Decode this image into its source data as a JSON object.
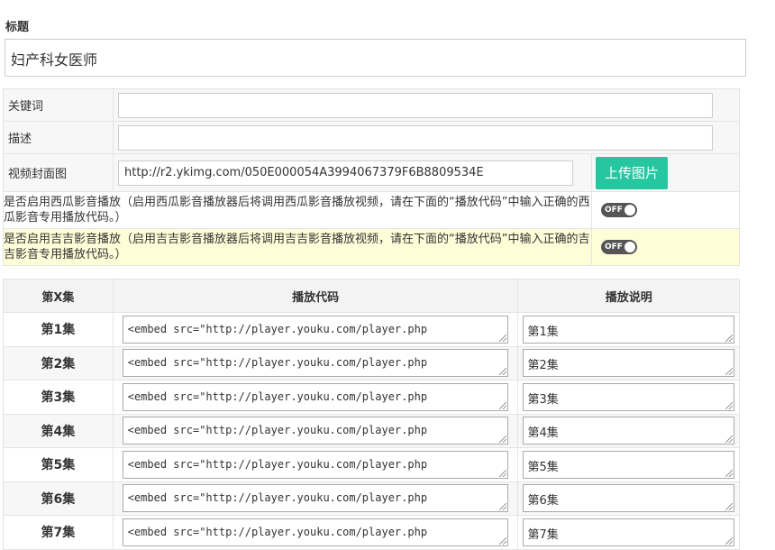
{
  "title": {
    "label": "标题",
    "value": "妇产科女医师"
  },
  "fields": {
    "keywords": {
      "label": "关键词",
      "value": ""
    },
    "description": {
      "label": "描述",
      "value": ""
    },
    "cover": {
      "label": "视频封面图",
      "value": "http://r2.ykimg.com/050E000054A3994067379F6B8809534E",
      "upload_button": "上传图片"
    },
    "xigua": {
      "label": "是否启用西瓜影音播放（启用西瓜影音播放器后将调用西瓜影音播放视频，请在下面的“播放代码”中输入正确的西瓜影音专用播放代码。）",
      "toggle": "OFF"
    },
    "jiji": {
      "label": "是否启用吉吉影音播放（启用吉吉影音播放器后将调用吉吉影音播放视频，请在下面的“播放代码”中输入正确的吉吉影音专用播放代码。）",
      "toggle": "OFF"
    }
  },
  "episodes": {
    "headers": {
      "episode": "第X集",
      "code": "播放代码",
      "note": "播放说明"
    },
    "rows": [
      {
        "label": "第1集",
        "code": "<embed src=\"http://player.youku.com/player.php",
        "note": "第1集"
      },
      {
        "label": "第2集",
        "code": "<embed src=\"http://player.youku.com/player.php",
        "note": "第2集"
      },
      {
        "label": "第3集",
        "code": "<embed src=\"http://player.youku.com/player.php",
        "note": "第3集"
      },
      {
        "label": "第4集",
        "code": "<embed src=\"http://player.youku.com/player.php",
        "note": "第4集"
      },
      {
        "label": "第5集",
        "code": "<embed src=\"http://player.youku.com/player.php",
        "note": "第5集"
      },
      {
        "label": "第6集",
        "code": "<embed src=\"http://player.youku.com/player.php",
        "note": "第6集"
      },
      {
        "label": "第7集",
        "code": "<embed src=\"http://player.youku.com/player.php",
        "note": "第7集"
      }
    ]
  },
  "colors": {
    "upload_button": "#26c6a0",
    "highlight_row": "#fffdd8",
    "toggle_off": "#555555"
  }
}
